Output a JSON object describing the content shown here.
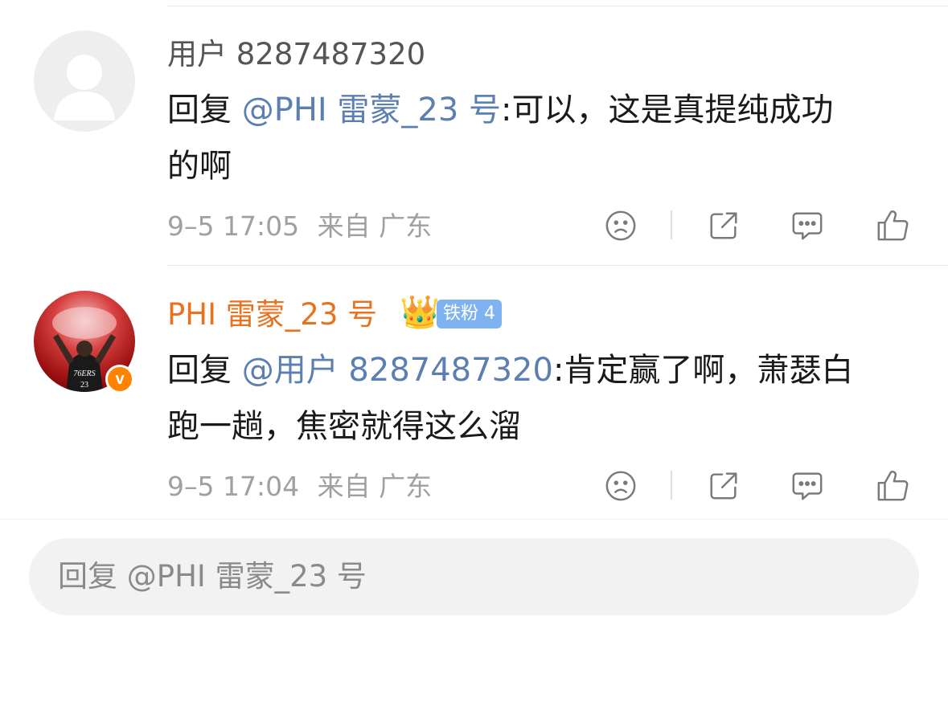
{
  "comments": [
    {
      "username": "用户 8287487320",
      "reply_prefix": "回复 ",
      "mention": "@PHI 雷蒙_23 号",
      "text_line1": ":可以，这是真提纯成功",
      "text_line2": "的啊",
      "time": "9–5 17:05",
      "location": "来自 广东",
      "avatar_icon": "default-avatar-icon"
    },
    {
      "username": "PHI 雷蒙_23 号",
      "crown": "👑",
      "fan_badge": "铁粉 4",
      "verified": "v",
      "reply_prefix": "回复 ",
      "mention": "@用户 8287487320",
      "text_line1": ":肯定赢了啊，萧瑟白",
      "text_line2": "跑一趟，焦密就得这么溜",
      "time": "9–5 17:04",
      "location": "来自 广东",
      "avatar_icon": "player-avatar-icon"
    }
  ],
  "reply_box": {
    "placeholder": "回复 @PHI 雷蒙_23 号"
  },
  "colors": {
    "accent_orange": "#e8721e",
    "mention_blue": "#5b7fb0",
    "meta_gray": "#a0a0a0"
  }
}
